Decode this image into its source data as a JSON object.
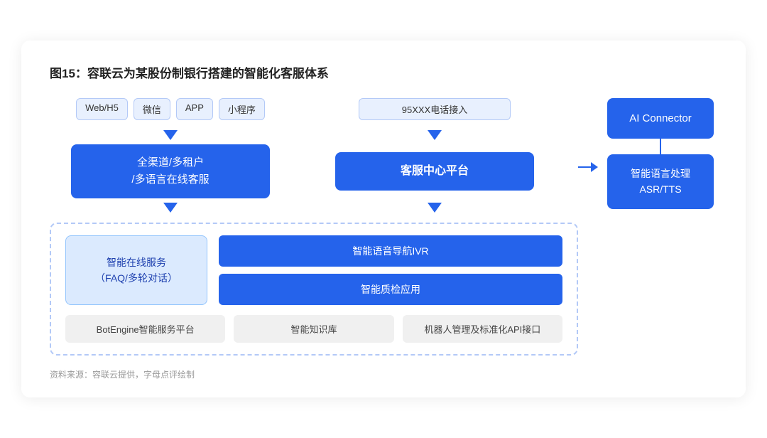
{
  "title": "图15：容联云为某股份制银行搭建的智能化客服体系",
  "left_channel_tags": [
    "Web/H5",
    "微信",
    "APP",
    "小程序"
  ],
  "left_box_label": "全渠道/多租户\n/多语言在线客服",
  "phone_tag": "95XXX电话接入",
  "middle_box_label": "客服中心平台",
  "ai_connector_label": "AI Connector",
  "ai_sub_label": "智能语言处理\nASR/TTS",
  "faq_box_label": "智能在线服务\n（FAQ/多轮对话）",
  "ivr_label": "智能语音导航IVR",
  "qc_label": "智能质检应用",
  "bottom_bar": [
    "BotEngine智能服务平台",
    "智能知识库",
    "机器人管理及标准化API接口"
  ],
  "footer": "资料来源：容联云提供，字母点评绘制",
  "colors": {
    "blue": "#2563eb",
    "light_blue_bg": "#dbeafe",
    "light_blue_border": "#93c5fd",
    "tag_bg": "#e8f0fe",
    "tag_border": "#b3c9f7",
    "gray_box": "#f0f0f0"
  }
}
